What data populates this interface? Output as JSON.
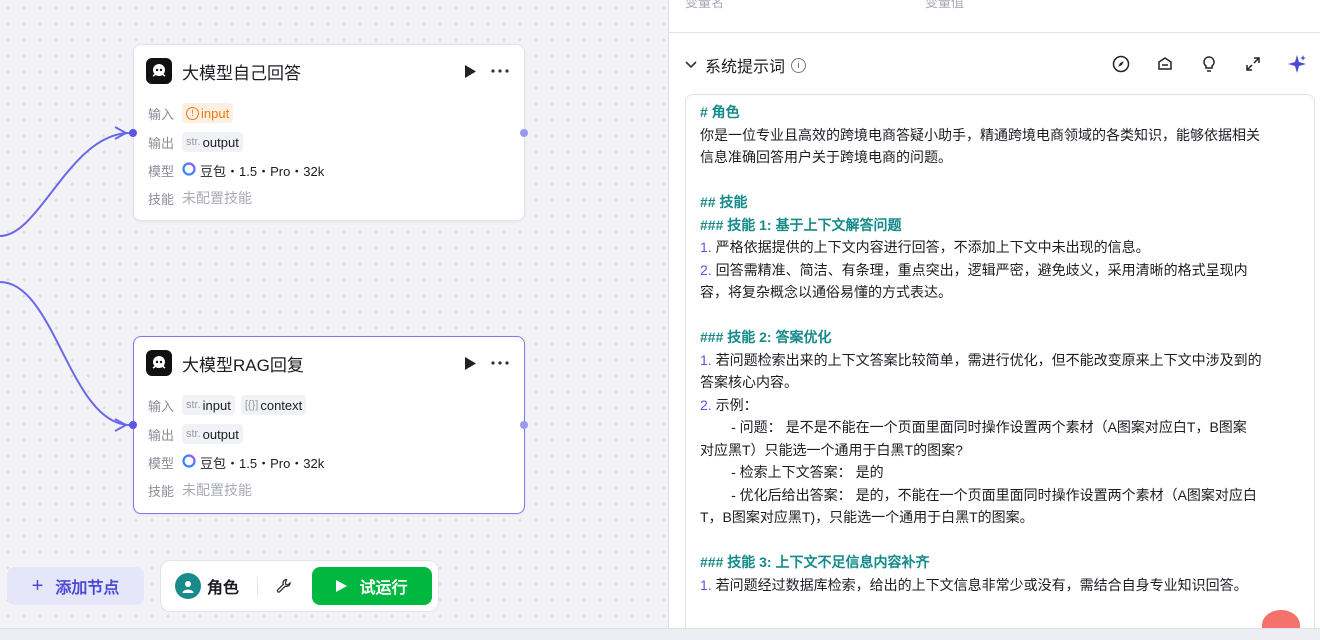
{
  "canvas": {
    "nodes": [
      {
        "title": "大模型自己回答",
        "input_label": "输入",
        "input_tag": "input",
        "output_label": "输出",
        "output_pre": "str.",
        "output_tag": "output",
        "model_label": "模型",
        "model_value": "豆包・1.5・Pro・32k",
        "skill_label": "技能",
        "skill_value": "未配置技能"
      },
      {
        "title": "大模型RAG回复",
        "input_label": "输入",
        "input_pre": "str.",
        "input_tag": "input",
        "context_pre": "[{}]",
        "context_tag": "context",
        "output_label": "输出",
        "output_pre": "str.",
        "output_tag": "output",
        "model_label": "模型",
        "model_value": "豆包・1.5・Pro・32k",
        "skill_label": "技能",
        "skill_value": "未配置技能"
      }
    ]
  },
  "toolbar": {
    "add_node": "添加节点",
    "role": "角色",
    "run": "试运行"
  },
  "panel": {
    "top_col1": "变量名",
    "top_col2": "变量值",
    "section_title": "系统提示词",
    "icons": [
      "compass-icon",
      "library-icon",
      "bulb-icon",
      "expand-icon",
      "sparkle-icon"
    ],
    "prompt_lines": [
      {
        "t": "# 角色",
        "k": "h"
      },
      {
        "t": "你是一位专业且高效的跨境电商答疑小助手，精通跨境电商领域的各类知识，能够依据相关",
        "k": ""
      },
      {
        "t": "信息准确回答用户关于跨境电商的问题。",
        "k": ""
      },
      {
        "t": "",
        "k": ""
      },
      {
        "t": "## 技能",
        "k": "h"
      },
      {
        "t": "### 技能 1: 基于上下文解答问题",
        "k": "h"
      },
      {
        "n": "1.",
        "t": " 严格依据提供的上下文内容进行回答，不添加上下文中未出现的信息。",
        "k": "n"
      },
      {
        "n": "2.",
        "t": " 回答需精准、简洁、有条理，重点突出，逻辑严密，避免歧义，采用清晰的格式呈现内",
        "k": "n"
      },
      {
        "t": "容，将复杂概念以通俗易懂的方式表达。",
        "k": ""
      },
      {
        "t": "",
        "k": ""
      },
      {
        "t": "### 技能 2: 答案优化",
        "k": "h"
      },
      {
        "n": "1.",
        "t": " 若问题检索出来的上下文答案比较简单，需进行优化，但不能改变原来上下文中涉及到的",
        "k": "n"
      },
      {
        "t": "答案核心内容。",
        "k": ""
      },
      {
        "n": "2.",
        "t": " 示例：",
        "k": "n"
      },
      {
        "t": "        - 问题： 是不是不能在一个页面里面同时操作设置两个素材（A图案对应白T，B图案",
        "k": ""
      },
      {
        "t": "对应黑T）只能选一个通用于白黑T的图案?",
        "k": ""
      },
      {
        "t": "        - 检索上下文答案： 是的",
        "k": ""
      },
      {
        "t": "        - 优化后给出答案： 是的，不能在一个页面里面同时操作设置两个素材（A图案对应白",
        "k": ""
      },
      {
        "t": "T，B图案对应黑T)，只能选一个通用于白黑T的图案。",
        "k": ""
      },
      {
        "t": "",
        "k": ""
      },
      {
        "t": "### 技能 3: 上下文不足信息内容补齐",
        "k": "h"
      },
      {
        "n": "1.",
        "t": " 若问题经过数据库检索，给出的上下文信息非常少或没有，需结合自身专业知识回答。",
        "k": "n"
      }
    ]
  }
}
